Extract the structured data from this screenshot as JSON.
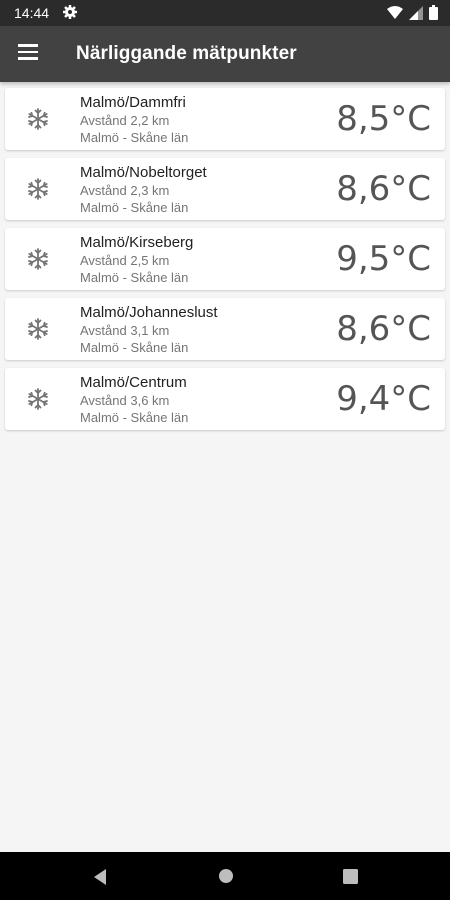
{
  "status_bar": {
    "time": "14:44"
  },
  "app_bar": {
    "title": "Närliggande mätpunkter"
  },
  "stations": [
    {
      "name": "Malmö/Dammfri",
      "distance": "Avstånd 2,2 km",
      "region": "Malmö - Skåne län",
      "temperature": "8,5°C",
      "icon": "snowflake-icon"
    },
    {
      "name": "Malmö/Nobeltorget",
      "distance": "Avstånd 2,3 km",
      "region": "Malmö - Skåne län",
      "temperature": "8,6°C",
      "icon": "snowflake-icon"
    },
    {
      "name": "Malmö/Kirseberg",
      "distance": "Avstånd 2,5 km",
      "region": "Malmö - Skåne län",
      "temperature": "9,5°C",
      "icon": "snowflake-icon"
    },
    {
      "name": "Malmö/Johanneslust",
      "distance": "Avstånd 3,1 km",
      "region": "Malmö - Skåne län",
      "temperature": "8,6°C",
      "icon": "snowflake-icon"
    },
    {
      "name": "Malmö/Centrum",
      "distance": "Avstånd 3,6 km",
      "region": "Malmö - Skåne län",
      "temperature": "9,4°C",
      "icon": "snowflake-icon"
    }
  ],
  "colors": {
    "app_bar": "#424242",
    "status_bar": "#2b2b2b",
    "background": "#f5f5f5"
  }
}
